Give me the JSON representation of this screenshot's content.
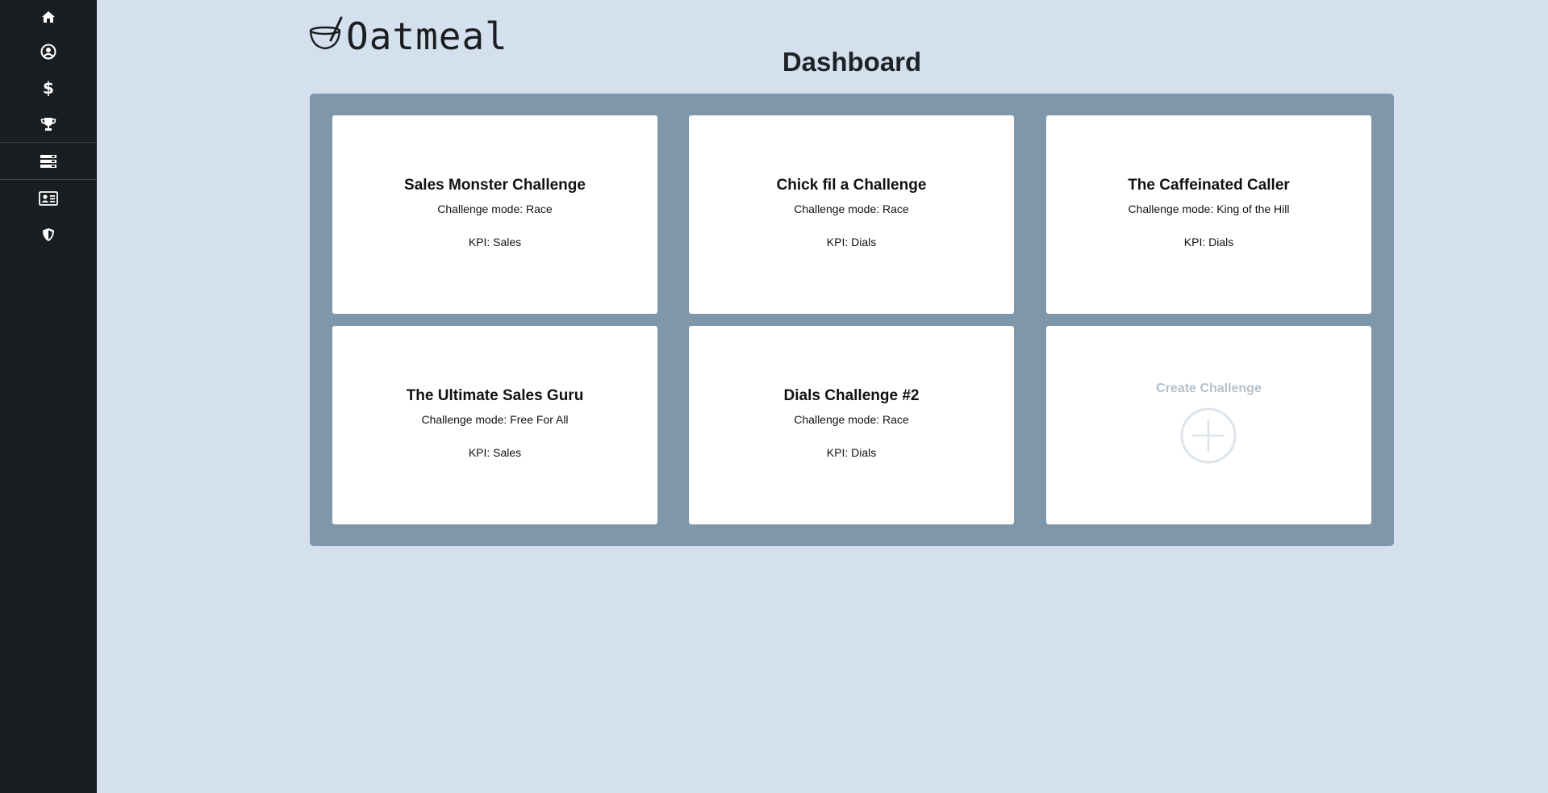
{
  "app": {
    "name": "Oatmeal"
  },
  "page": {
    "title": "Dashboard"
  },
  "sidebar": {
    "items": [
      {
        "icon": "home-icon"
      },
      {
        "icon": "user-circle-icon"
      },
      {
        "icon": "dollar-icon"
      },
      {
        "icon": "trophy-icon"
      },
      {
        "icon": "server-icon"
      },
      {
        "icon": "id-card-icon"
      },
      {
        "icon": "shield-icon"
      }
    ]
  },
  "challenges": [
    {
      "title": "Sales Monster Challenge",
      "mode": "Challenge mode: Race",
      "kpi": "KPI: Sales"
    },
    {
      "title": "Chick fil a Challenge",
      "mode": "Challenge mode: Race",
      "kpi": "KPI: Dials"
    },
    {
      "title": "The Caffeinated Caller",
      "mode": "Challenge mode: King of the Hill",
      "kpi": "KPI: Dials"
    },
    {
      "title": "The Ultimate Sales Guru",
      "mode": "Challenge mode: Free For All",
      "kpi": "KPI: Sales"
    },
    {
      "title": "Dials Challenge #2",
      "mode": "Challenge mode: Race",
      "kpi": "KPI: Dials"
    }
  ],
  "create": {
    "label": "Create Challenge",
    "icon": "plus-circle-icon"
  },
  "colors": {
    "background": "#d4e0ee",
    "sidebar": "#1b1e20",
    "board": "#7f97ab",
    "card": "#ffffff",
    "create_muted": "#b4c1cc"
  }
}
